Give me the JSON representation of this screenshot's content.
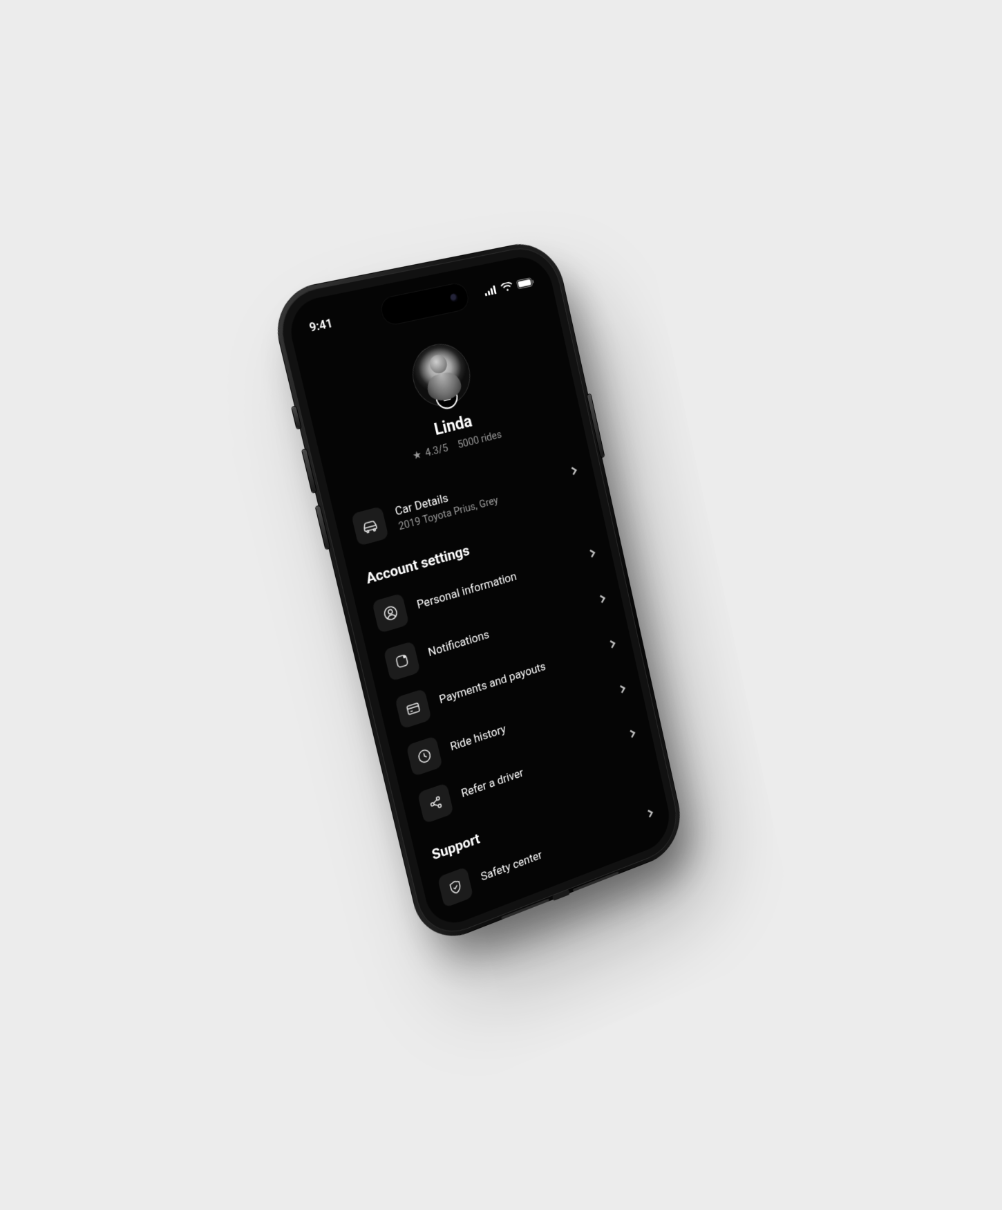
{
  "status": {
    "time": "9:41"
  },
  "profile": {
    "name": "Linda",
    "rating": "4.3/5",
    "rides": "5000 rides"
  },
  "car": {
    "title": "Car Details",
    "subtitle": "2019 Toyota Prius, Grey"
  },
  "sections": {
    "account": {
      "heading": "Account settings",
      "items": [
        {
          "label": "Personal information"
        },
        {
          "label": "Notifications"
        },
        {
          "label": "Payments and payouts"
        },
        {
          "label": "Ride history"
        },
        {
          "label": "Refer a driver"
        }
      ]
    },
    "support": {
      "heading": "Support",
      "items": [
        {
          "label": "Safety center"
        }
      ]
    }
  }
}
